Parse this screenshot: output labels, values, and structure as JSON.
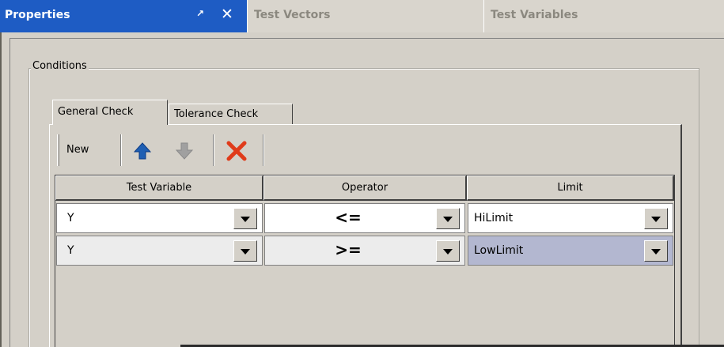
{
  "tabs": {
    "properties": "Properties",
    "pin_glyph": "↗",
    "close_glyph": "✕",
    "test_vectors": "Test Vectors",
    "test_variables": "Test Variables"
  },
  "conditions": {
    "legend": "Conditions",
    "tabs": [
      "General Check",
      "Tolerance Check"
    ],
    "toolbar": {
      "new_label": "New",
      "icons": [
        "move-up-icon",
        "move-down-icon",
        "delete-icon"
      ]
    },
    "grid": {
      "headers": [
        "Test Variable",
        "Operator",
        "Limit"
      ],
      "rows": [
        {
          "variable": "Y",
          "operator": "<=",
          "limit": "HiLimit"
        },
        {
          "variable": "Y",
          "operator": ">=",
          "limit": "LowLimit"
        }
      ]
    }
  },
  "colors": {
    "active_tab": "#1e5cc4",
    "selected_cell": "#b3b7d0",
    "up_arrow": "#1f5fb3",
    "down_arrow": "#a0a0a0",
    "delete_x": "#e03b1a"
  }
}
